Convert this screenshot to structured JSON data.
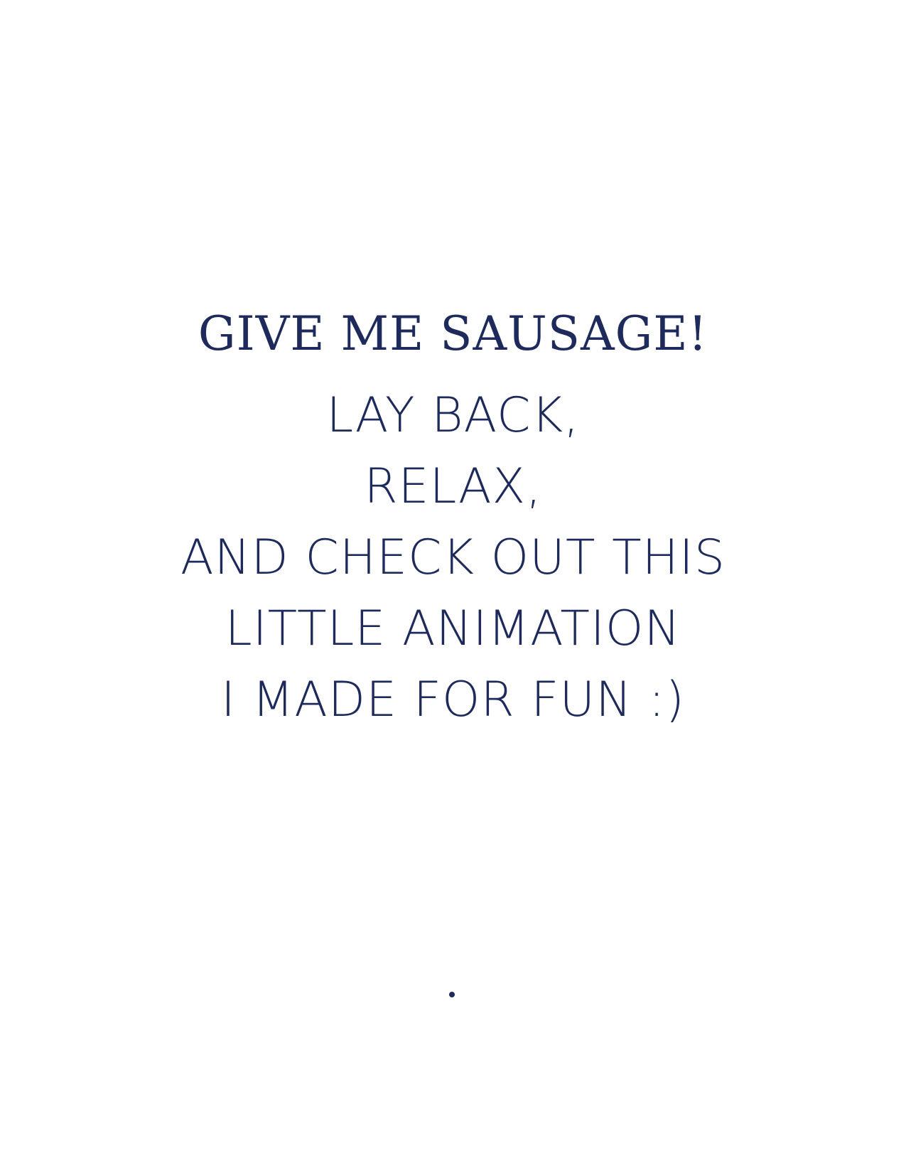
{
  "title": "GIVE ME SAUSAGE!",
  "lines": [
    "LAY BACK,",
    "RELAX,",
    "AND CHECK OUT THIS",
    "LITTLE ANIMATION",
    "I MADE FOR FUN :)"
  ],
  "colors": {
    "text": "#1d2a5b",
    "background": "#ffffff",
    "dot": "#1d2a5b"
  }
}
